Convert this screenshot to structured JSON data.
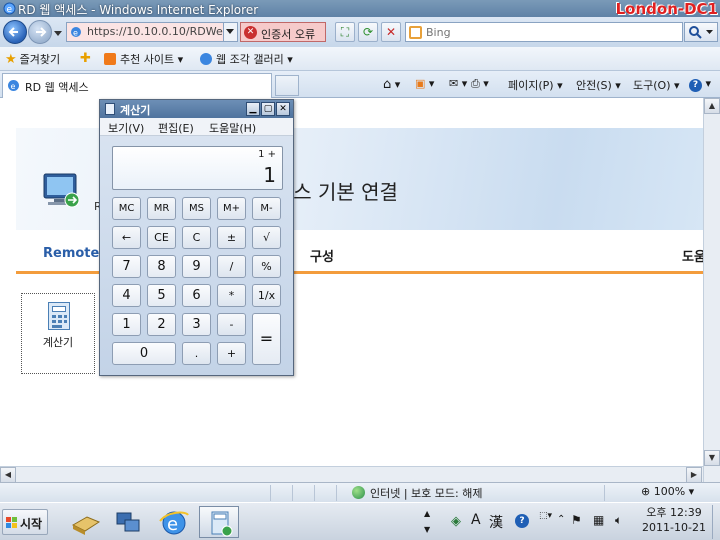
{
  "browser": {
    "window_title": "RD 웹 액세스 - Windows Internet Explorer",
    "watermark": "London-DC1",
    "address_url": "https://10.10.0.10/RDWeb/",
    "cert_error_label": "인증서 오류",
    "search_placeholder": "Bing",
    "favorites_label": "즐겨찾기",
    "fav_items": [
      "추천 사이트 ▾",
      "웹 조각 갤러리 ▾"
    ],
    "tab_title": "RD 웹 액세스",
    "commands": [
      "페이지(P) ▾",
      "안전(S) ▾",
      "도구(O) ▾"
    ],
    "status_zone": "인터넷 | 보호 모드: 해제",
    "zoom": "100%"
  },
  "page": {
    "heading": "스 기본 연결",
    "heading_prefix": "-",
    "subtitle": "R",
    "nav_left": "RemoteA",
    "nav_mid": "구성",
    "nav_right": "도움",
    "app_label": "계산기"
  },
  "calculator": {
    "title": "계산기",
    "menus": [
      "보기(V)",
      "편집(E)",
      "도움말(H)"
    ],
    "display_memo": "1 +",
    "display_value": "1",
    "rows": [
      [
        "MC",
        "MR",
        "MS",
        "M+",
        "M-"
      ],
      [
        "←",
        "CE",
        "C",
        "±",
        "√"
      ],
      [
        "7",
        "8",
        "9",
        "/",
        "%"
      ],
      [
        "4",
        "5",
        "6",
        "*",
        "1/x"
      ],
      [
        "1",
        "2",
        "3",
        "-"
      ],
      [
        "0",
        ".",
        "+"
      ]
    ],
    "equals": "="
  },
  "taskbar": {
    "start_label": "시작",
    "ime_labels": [
      "A",
      "漢"
    ],
    "clock_ampm_time": "오후 12:39",
    "clock_date": "2011-10-21"
  }
}
